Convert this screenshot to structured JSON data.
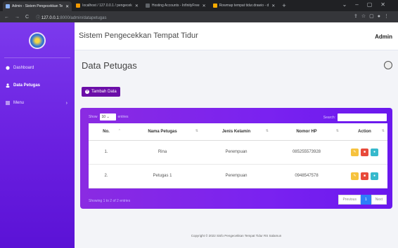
{
  "browser": {
    "tabs": [
      {
        "label": "Admin - Sistem Pengecekkan Te",
        "active": true,
        "color": "#8ab4f8"
      },
      {
        "label": "localhost / 127.0.0.1 / pengecek",
        "active": false,
        "color": "#f29900"
      },
      {
        "label": "Hosting Accounts - InfinityFree",
        "active": false,
        "color": "#5f6368"
      },
      {
        "label": "Rowmap tempat tidur.drawio - d",
        "active": false,
        "color": "#f9ab00"
      }
    ],
    "new_tab": "+",
    "url_host": "127.0.0.1",
    "url_path": ":8000/admin/datapetugas",
    "url_prefix": "ⓘ "
  },
  "app": {
    "title": "Sistem Pengecekkan Tempat Tidur",
    "user": "Admin"
  },
  "sidebar": {
    "items": [
      {
        "label": "Dashboard",
        "icon": "dashboard-icon"
      },
      {
        "label": "Data Petugas",
        "icon": "user-icon"
      },
      {
        "label": "Menu",
        "icon": "menu-icon"
      }
    ]
  },
  "page": {
    "title": "Data Petugas",
    "add_button": "Tambah Data"
  },
  "table_controls": {
    "show_label": "Show",
    "entries_value": "10",
    "entries_label": "entries",
    "search_label": "Search:"
  },
  "table": {
    "headers": [
      "No.",
      "Nama Petugas",
      "Jenis Kelamin",
      "Nomor HP",
      "Action"
    ],
    "rows": [
      {
        "no": "1.",
        "nama": "Rina",
        "jenis": "Perempuan",
        "hp": "085255573928"
      },
      {
        "no": "2.",
        "nama": "Petugas 1",
        "jenis": "Perempuan",
        "hp": "0948547578"
      }
    ],
    "action_colors": {
      "edit": "#f6c23e",
      "delete": "#e74a3b",
      "view": "#36b9cc"
    }
  },
  "pagination": {
    "info": "Showing 1 to 2 of 2 entries",
    "previous": "Previous",
    "current": "1",
    "next": "Next"
  },
  "footer": {
    "copyright": "Copyright © 2022 Sisfo Pengecekkan Tempat Tidur RS Salamun"
  }
}
